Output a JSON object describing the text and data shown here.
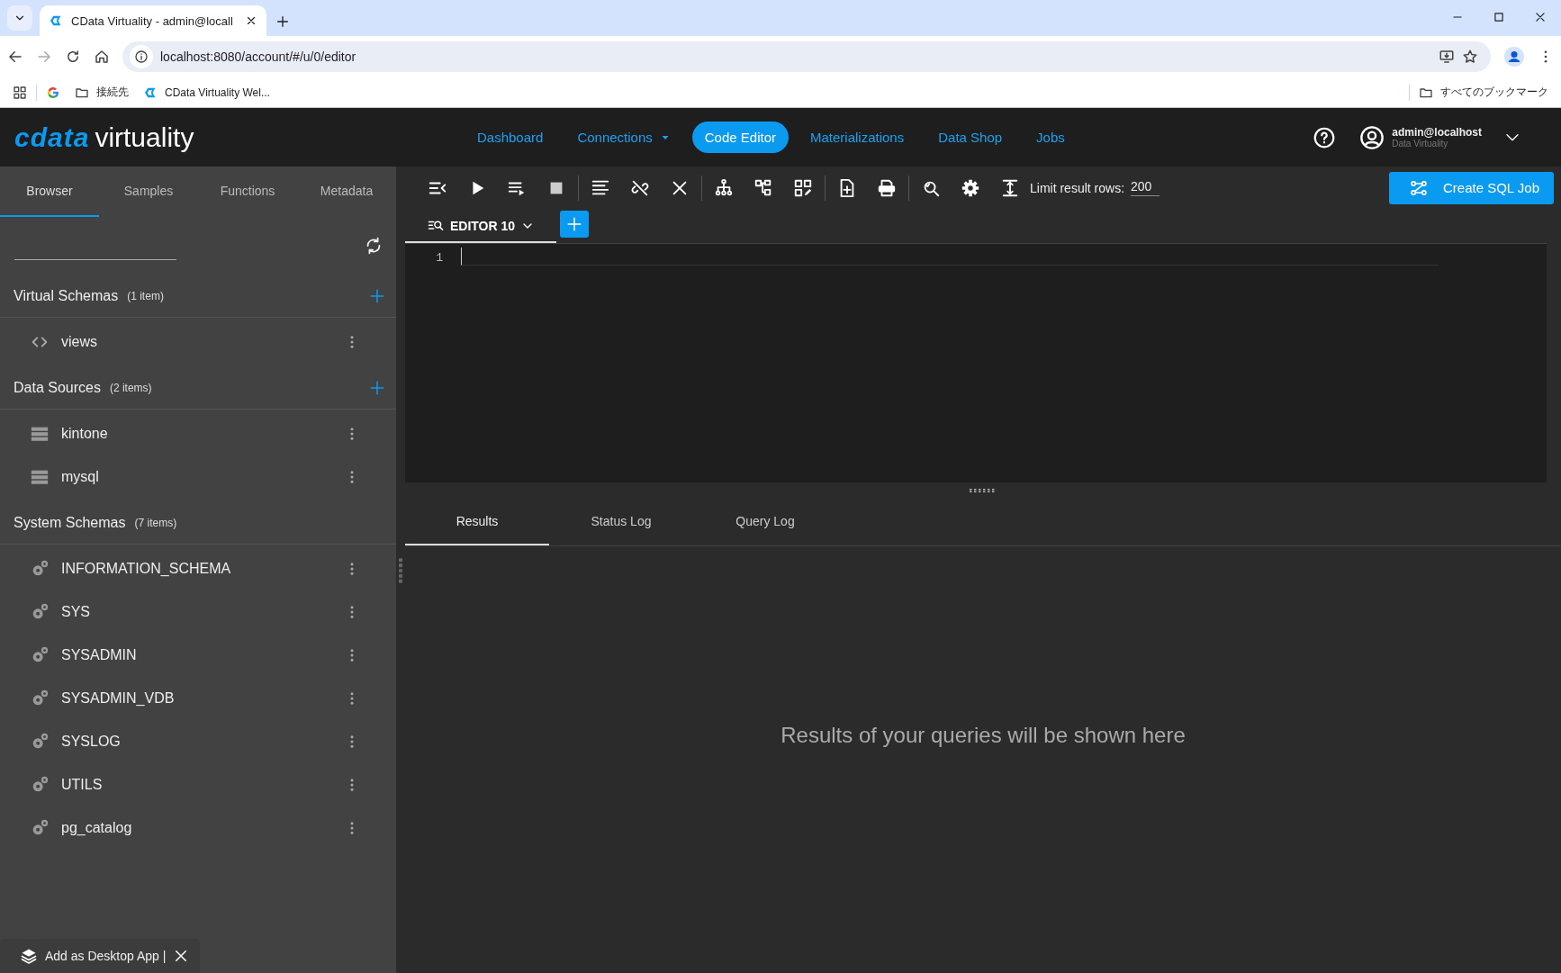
{
  "browser": {
    "tab_title": "CData Virtuality - admin@locall",
    "url": "localhost:8080/account/#/u/0/editor",
    "bookmarks": [
      {
        "label": "接続先",
        "kind": "folder"
      },
      {
        "label": "CData Virtuality Wel...",
        "kind": "site"
      }
    ],
    "all_bookmarks": "すべてのブックマーク"
  },
  "app": {
    "logo": {
      "brand": "cdata",
      "product": "virtuality"
    },
    "nav": [
      {
        "label": "Dashboard",
        "selected": false,
        "dropdown": false
      },
      {
        "label": "Connections",
        "selected": false,
        "dropdown": true
      },
      {
        "label": "Code Editor",
        "selected": true,
        "dropdown": false
      },
      {
        "label": "Materializations",
        "selected": false,
        "dropdown": false
      },
      {
        "label": "Data Shop",
        "selected": false,
        "dropdown": false
      },
      {
        "label": "Jobs",
        "selected": false,
        "dropdown": false
      }
    ],
    "user": {
      "name": "admin@localhost",
      "org": "Data Virtuality"
    }
  },
  "sidebar": {
    "tabs": [
      {
        "label": "Browser",
        "selected": true
      },
      {
        "label": "Samples",
        "selected": false
      },
      {
        "label": "Functions",
        "selected": false
      },
      {
        "label": "Metadata",
        "selected": false
      }
    ],
    "sections": [
      {
        "title": "Virtual Schemas",
        "count": "(1 item)",
        "addable": true,
        "items": [
          {
            "name": "views",
            "kind": "view"
          }
        ]
      },
      {
        "title": "Data Sources",
        "count": "(2 items)",
        "addable": true,
        "items": [
          {
            "name": "kintone",
            "kind": "source"
          },
          {
            "name": "mysql",
            "kind": "source"
          }
        ]
      },
      {
        "title": "System Schemas",
        "count": "(7 items)",
        "addable": false,
        "items": [
          {
            "name": "INFORMATION_SCHEMA",
            "kind": "system"
          },
          {
            "name": "SYS",
            "kind": "system"
          },
          {
            "name": "SYSADMIN",
            "kind": "system"
          },
          {
            "name": "SYSADMIN_VDB",
            "kind": "system"
          },
          {
            "name": "SYSLOG",
            "kind": "system"
          },
          {
            "name": "UTILS",
            "kind": "system"
          },
          {
            "name": "pg_catalog",
            "kind": "system"
          }
        ]
      }
    ]
  },
  "toolbar": {
    "limit_label": "Limit result rows:",
    "limit_value": "200",
    "create_button": "Create SQL Job"
  },
  "editor_tabs": [
    {
      "label": "EDITOR 10",
      "selected": true
    }
  ],
  "editor": {
    "line_numbers": [
      "1"
    ]
  },
  "results": {
    "tabs": [
      {
        "label": "Results",
        "selected": true
      },
      {
        "label": "Status Log",
        "selected": false
      },
      {
        "label": "Query Log",
        "selected": false
      }
    ],
    "empty_message": "Results of your queries will be shown here"
  },
  "install_banner": {
    "label": "Add as Desktop App |"
  }
}
